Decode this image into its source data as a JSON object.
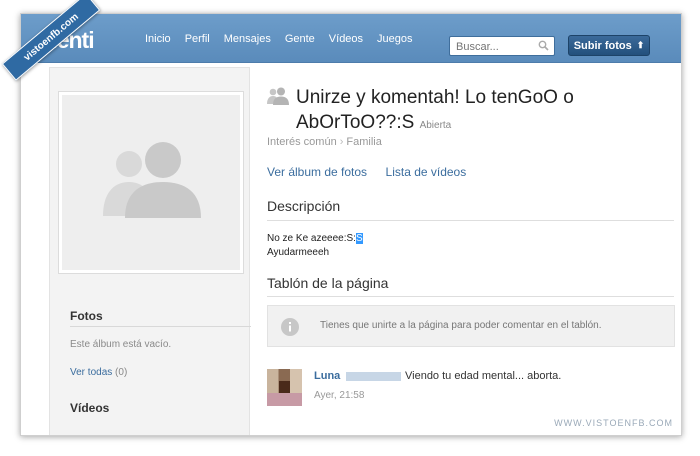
{
  "watermark": {
    "ribbon_text": "vistoenfb.com",
    "footer_text": "WWW.VISTOENFB.COM"
  },
  "topbar": {
    "logo": "tuenti",
    "nav": [
      "Inicio",
      "Perfil",
      "Mensajes",
      "Gente",
      "Vídeos",
      "Juegos"
    ],
    "search_placeholder": "Buscar...",
    "upload_label": "Subir fotos"
  },
  "sidebar": {
    "photos_heading": "Fotos",
    "photos_empty": "Este álbum está vacío.",
    "photos_link": "Ver todas",
    "photos_count": "(0)",
    "videos_heading": "Vídeos"
  },
  "page": {
    "title": "Unirze y komentah! Lo tenGoO o AbOrToO??:S",
    "status": "Abierta",
    "category": "Interés común",
    "subcategory": "Familia",
    "links": [
      "Ver álbum de fotos",
      "Lista de vídeos"
    ],
    "description_heading": "Descripción",
    "description_line1": "No ze Ke azeeee:S:",
    "description_highlight": "S",
    "description_line2": "Ayudarmeeeh",
    "board_heading": "Tablón de la página",
    "board_notice": "Tienes que unirte a la página para poder comentar en el tablón."
  },
  "comment": {
    "author": "Luna",
    "text": "Viendo tu edad mental... aborta.",
    "time": "Ayer, 21:58"
  }
}
